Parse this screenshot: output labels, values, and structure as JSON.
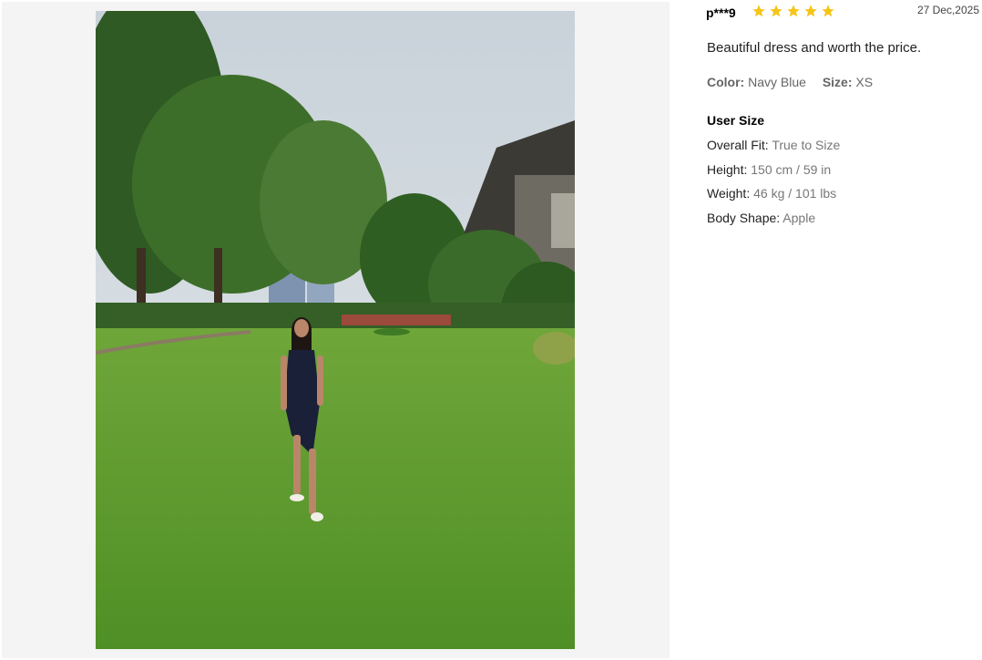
{
  "review": {
    "username": "p***9",
    "rating": 5,
    "rating_max": 5,
    "date": "27 Dec,2025",
    "comment": "Beautiful dress and worth the price.",
    "color_label": "Color:",
    "color_value": "Navy Blue",
    "size_label": "Size:",
    "size_value": "XS"
  },
  "user_size": {
    "title": "User Size",
    "fit_label": "Overall Fit:",
    "fit_value": "True to Size",
    "height_label": "Height:",
    "height_value": "150 cm / 59 in",
    "weight_label": "Weight:",
    "weight_value": "46 kg / 101 lbs",
    "shape_label": "Body Shape:",
    "shape_value": "Apple"
  },
  "colors": {
    "star": "#f5c518",
    "panel_bg": "#f4f4f4"
  },
  "icons": {
    "star": "star-icon"
  }
}
